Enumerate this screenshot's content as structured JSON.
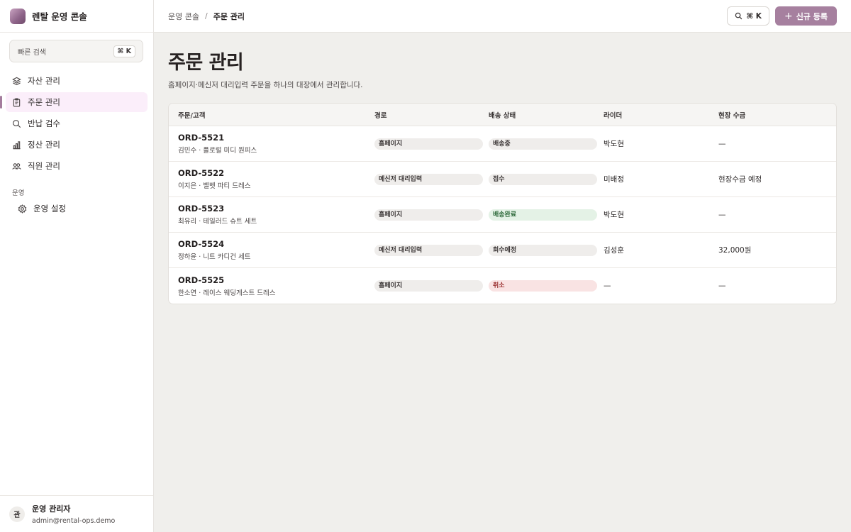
{
  "app": {
    "name": "렌탈 운영 콘솔"
  },
  "search": {
    "label": "빠른 검색",
    "shortcut": "⌘ K"
  },
  "nav": {
    "items": [
      {
        "label": "자산 관리",
        "icon": "layers-icon",
        "active": false
      },
      {
        "label": "주문 관리",
        "icon": "clipboard-icon",
        "active": true
      },
      {
        "label": "반납 검수",
        "icon": "search-icon",
        "active": false
      },
      {
        "label": "정산 관리",
        "icon": "bar-chart-icon",
        "active": false
      },
      {
        "label": "직원 관리",
        "icon": "users-icon",
        "active": false
      }
    ],
    "section_label": "운영",
    "section_items": [
      {
        "label": "운영 설정",
        "icon": "gear-icon"
      }
    ]
  },
  "user": {
    "initial": "관",
    "name": "운영 관리자",
    "email": "admin@rental-ops.demo"
  },
  "topbar": {
    "breadcrumb_parent": "운영 콘솔",
    "breadcrumb_sep": "/",
    "breadcrumb_current": "주문 관리",
    "search_shortcut": "⌘ K",
    "new_button": "신규 등록"
  },
  "page": {
    "title": "주문 관리",
    "subtitle": "홈페이지·메신저 대리입력 주문을 하나의 대장에서 관리합니다."
  },
  "table": {
    "headers": [
      "주문/고객",
      "경로",
      "배송 상태",
      "라이더",
      "현장 수금"
    ],
    "rows": [
      {
        "id": "ORD-5521",
        "customer": "김민수 · 플로럴 미디 원피스",
        "channel": "홈페이지",
        "status": "배송중",
        "status_tone": "neutral",
        "rider": "박도현",
        "collection": "—"
      },
      {
        "id": "ORD-5522",
        "customer": "이지은 · 벨벳 파티 드레스",
        "channel": "메신저 대리입력",
        "status": "접수",
        "status_tone": "neutral",
        "rider": "미배정",
        "collection": "현장수금 예정"
      },
      {
        "id": "ORD-5523",
        "customer": "최유리 · 테일러드 슈트 세트",
        "channel": "홈페이지",
        "status": "배송완료",
        "status_tone": "done",
        "rider": "박도현",
        "collection": "—"
      },
      {
        "id": "ORD-5524",
        "customer": "정하윤 · 니트 카디건 세트",
        "channel": "메신저 대리입력",
        "status": "회수예정",
        "status_tone": "neutral",
        "rider": "김성훈",
        "collection": "32,000원"
      },
      {
        "id": "ORD-5525",
        "customer": "한소연 · 레이스 웨딩게스트 드레스",
        "channel": "홈페이지",
        "status": "취소",
        "status_tone": "cancel",
        "rider": "—",
        "collection": "—"
      }
    ]
  },
  "colors": {
    "accent": "#a6809f",
    "active_bg": "#fbeefa",
    "done_bg": "#e4f2e6",
    "cancel_bg": "#f9e3e3"
  }
}
